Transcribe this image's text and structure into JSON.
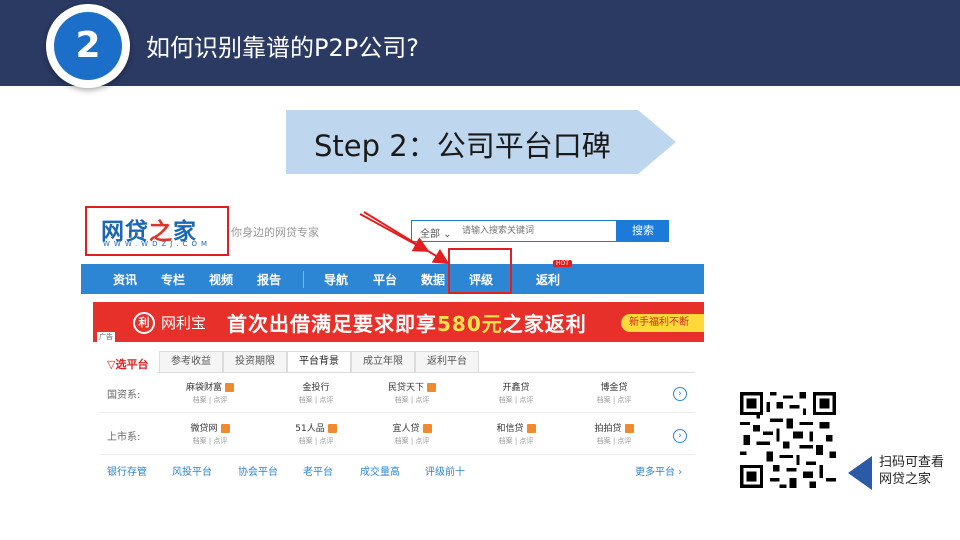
{
  "slide": {
    "step_number": "2",
    "title": "如何识别靠谱的P2P公司?",
    "step_label": "Step 2：公司平台口碑",
    "qr_caption_line1": "扫码可查看",
    "qr_caption_line2": "网贷之家"
  },
  "colors": {
    "header_bg": "#2b3a63",
    "accent_blue": "#1b6fc8",
    "banner_blue": "#bfd7ee",
    "highlight_red": "#e02020"
  },
  "site": {
    "logo_text_a": "网贷",
    "logo_text_b": "之",
    "logo_text_c": "家",
    "logo_url_text": "WWW.WDZJ.COM",
    "slogan": "你身边的网贷专家",
    "search": {
      "scope": "全部 ⌄",
      "placeholder": "请输入搜索关键词",
      "button": "搜索"
    },
    "nav": [
      "资讯",
      "专栏",
      "视频",
      "报告",
      "导航",
      "平台",
      "数据",
      "评级",
      "返利"
    ],
    "nav_hot_badge": "HOT",
    "ad": {
      "brand_icon": "利",
      "brand": "网利宝",
      "slogan_a": "首次出借满足要求即享",
      "slogan_amount": "580元",
      "slogan_b": "之家返利",
      "pill": "新手福利不断",
      "tag": "广告"
    },
    "filter": {
      "logo": "▽选平台",
      "tabs": [
        "参考收益",
        "投资期限",
        "平台背景",
        "成立年限",
        "返利平台"
      ],
      "active_tab": "平台背景"
    },
    "rows": [
      {
        "label": "国资系:",
        "platforms": [
          {
            "name": "麻袋财富",
            "sub": "档案 | 点评",
            "badge": true
          },
          {
            "name": "金投行",
            "sub": "档案 | 点评",
            "badge": false
          },
          {
            "name": "民贷天下",
            "sub": "档案 | 点评",
            "badge": true
          },
          {
            "name": "开鑫贷",
            "sub": "档案 | 点评",
            "badge": false
          },
          {
            "name": "博金贷",
            "sub": "档案 | 点评",
            "badge": false
          }
        ]
      },
      {
        "label": "上市系:",
        "platforms": [
          {
            "name": "微贷网",
            "sub": "档案 | 点评",
            "badge": true
          },
          {
            "name": "51人品",
            "sub": "档案 | 点评",
            "badge": true
          },
          {
            "name": "宜人贷",
            "sub": "档案 | 点评",
            "badge": true
          },
          {
            "name": "和信贷",
            "sub": "档案 | 点评",
            "badge": true
          },
          {
            "name": "拍拍贷",
            "sub": "档案 | 点评",
            "badge": true
          }
        ]
      }
    ],
    "footer_links": [
      "银行存管",
      "风投平台",
      "协会平台",
      "老平台",
      "成交量高",
      "评级前十"
    ],
    "more_link": "更多平台 ›"
  }
}
